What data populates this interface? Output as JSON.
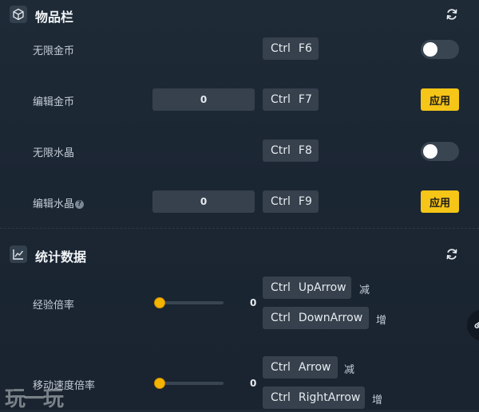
{
  "inventory": {
    "title": "物品栏",
    "icon": "cube-icon",
    "rows": [
      {
        "label": "无限金币",
        "hotkey": [
          "Ctrl",
          "F6"
        ],
        "control": "toggle",
        "toggle_on": false
      },
      {
        "label": "编辑金币",
        "input_value": "0",
        "hotkey": [
          "Ctrl",
          "F7"
        ],
        "control": "apply",
        "apply_label": "应用"
      },
      {
        "label": "无限水晶",
        "hotkey": [
          "Ctrl",
          "F8"
        ],
        "control": "toggle",
        "toggle_on": false
      },
      {
        "label": "编辑水晶",
        "help_icon": "question-icon",
        "help_glyph": "?",
        "input_value": "0",
        "hotkey": [
          "Ctrl",
          "F9"
        ],
        "control": "apply",
        "apply_label": "应用"
      }
    ]
  },
  "stats": {
    "title": "统计数据",
    "icon": "line-chart-icon",
    "rows": [
      {
        "label": "经验倍率",
        "slider_value": "0",
        "decrease": {
          "hotkey": [
            "Ctrl",
            "UpArrow"
          ],
          "label": "减"
        },
        "increase": {
          "hotkey": [
            "Ctrl",
            "DownArrow"
          ],
          "label": "增"
        }
      },
      {
        "label": "移动速度倍率",
        "slider_value": "0",
        "decrease": {
          "hotkey": [
            "Ctrl",
            "Arrow"
          ],
          "label": "减"
        },
        "increase": {
          "hotkey": [
            "Ctrl",
            "RightArrow"
          ],
          "label": "增"
        }
      }
    ]
  },
  "watermark": "玩一玩",
  "colors": {
    "accent": "#f5c517",
    "slider": "#f5b400",
    "background": "#1b2633",
    "panel": "#36414d"
  }
}
